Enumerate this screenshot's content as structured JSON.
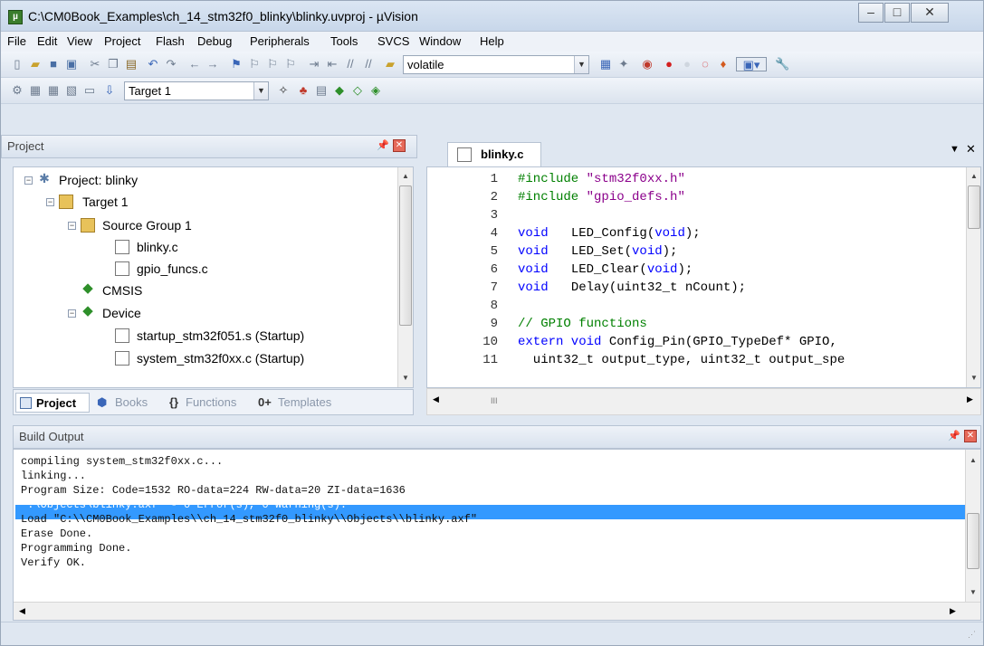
{
  "window": {
    "title": "C:\\CM0Book_Examples\\ch_14_stm32f0_blinky\\blinky.uvproj - µVision"
  },
  "menu": [
    "File",
    "Edit",
    "View",
    "Project",
    "Flash",
    "Debug",
    "Peripherals",
    "Tools",
    "SVCS",
    "Window",
    "Help"
  ],
  "toolbar": {
    "find_combo": "volatile",
    "target_combo": "Target 1"
  },
  "project_pane": {
    "title": "Project",
    "tree": [
      {
        "label": "Project: blinky"
      },
      {
        "label": "Target 1"
      },
      {
        "label": "Source Group 1"
      },
      {
        "label": "blinky.c"
      },
      {
        "label": "gpio_funcs.c"
      },
      {
        "label": "CMSIS"
      },
      {
        "label": "Device"
      },
      {
        "label": "startup_stm32f051.s (Startup)"
      },
      {
        "label": "system_stm32f0xx.c (Startup)"
      }
    ],
    "tabs": [
      "Project",
      "Books",
      "Functions",
      "Templates"
    ]
  },
  "editor": {
    "tab": "blinky.c",
    "lines": [
      {
        "n": "1",
        "kw": "",
        "text": "#include \"stm32f0xx.h\""
      },
      {
        "n": "2",
        "kw": "",
        "text": "#include \"gpio_defs.h\""
      },
      {
        "n": "3",
        "kw": "",
        "text": ""
      },
      {
        "n": "4",
        "kw": "void",
        "text": "   LED_Config(void);"
      },
      {
        "n": "5",
        "kw": "void",
        "text": "   LED_Set(void);"
      },
      {
        "n": "6",
        "kw": "void",
        "text": "   LED_Clear(void);"
      },
      {
        "n": "7",
        "kw": "void",
        "text": "   Delay(uint32_t nCount);"
      },
      {
        "n": "8",
        "kw": "",
        "text": ""
      },
      {
        "n": "9",
        "kw": "",
        "text": "// GPIO functions"
      },
      {
        "n": "10",
        "kw": "",
        "text": "extern void Config_Pin(GPIO_TypeDef* GPIO,"
      },
      {
        "n": "11",
        "kw": "",
        "text": "  uint32_t output_type, uint32_t output_spe"
      }
    ]
  },
  "build_output": {
    "title": "Build Output",
    "lines": [
      "compiling system_stm32f0xx.c...",
      "linking...",
      "Program Size: Code=1532 RO-data=224 RW-data=20 ZI-data=1636",
      "\".\\Objects\\blinky.axf\" - 0 Error(s), 0 Warning(s).",
      "Load \"C:\\\\CM0Book_Examples\\\\ch_14_stm32f0_blinky\\\\Objects\\\\blinky.axf\"",
      "Erase Done.",
      "Programming Done.",
      "Verify OK."
    ]
  },
  "colors": {
    "selection": "#3399ff",
    "keyword": "#0000ff",
    "string": "#8b008b",
    "comment": "#008000"
  }
}
